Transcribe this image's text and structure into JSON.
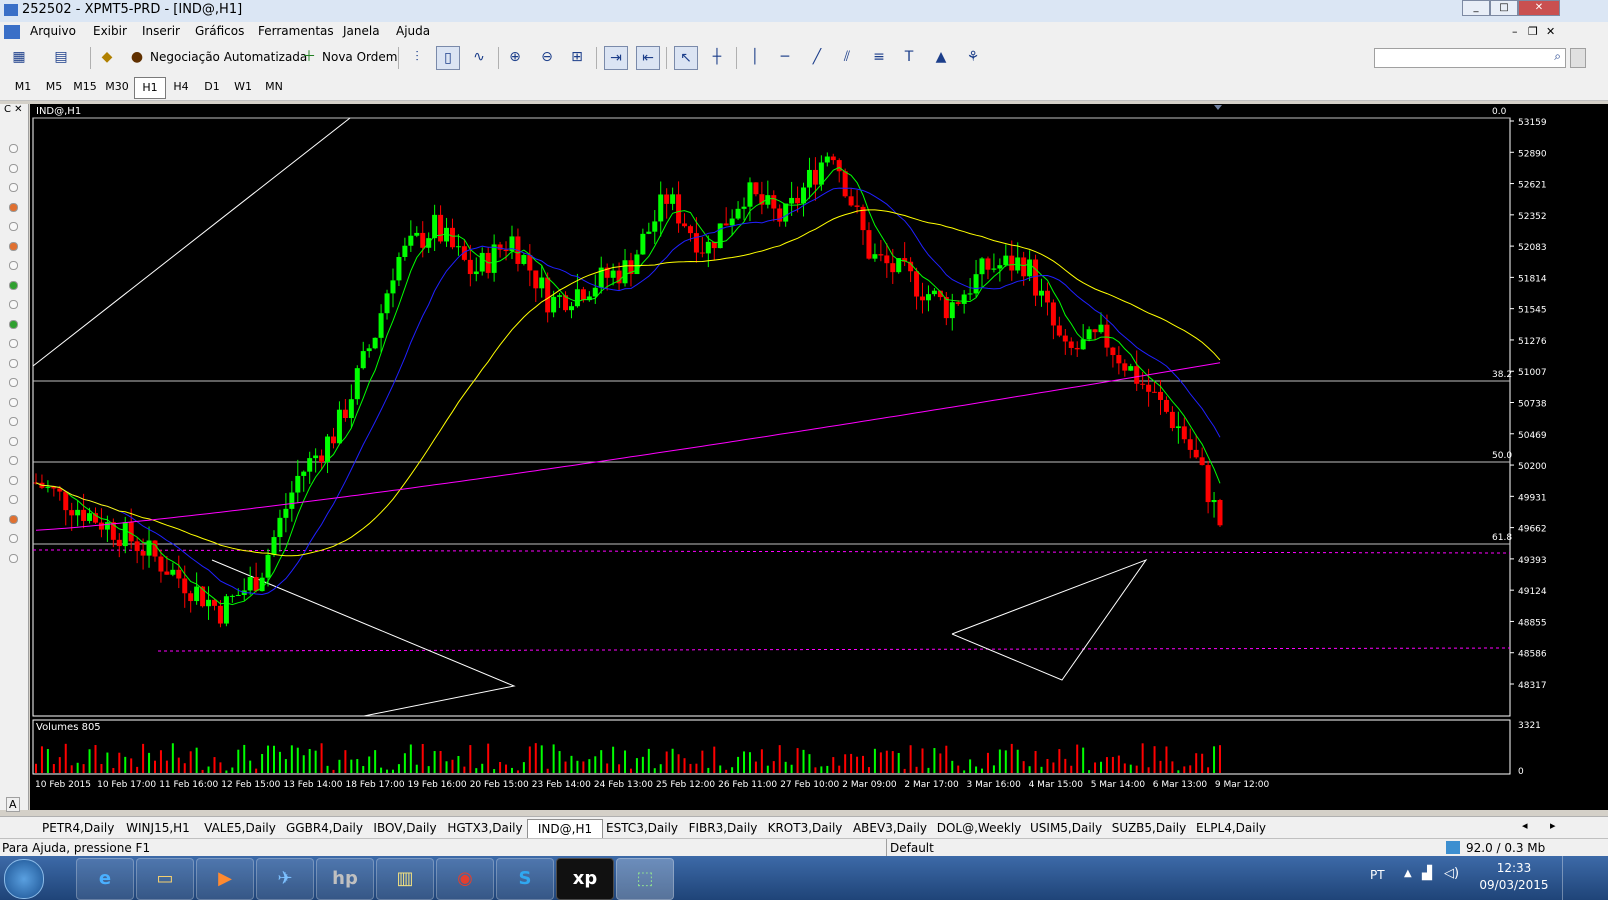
{
  "window": {
    "title": "252502 - XPMT5-PRD - [IND@,H1]"
  },
  "menu": [
    "Arquivo",
    "Exibir",
    "Inserir",
    "Gráficos",
    "Ferramentas",
    "Janela",
    "Ajuda"
  ],
  "toolbar": {
    "auto_trading": "Negociação Automatizada",
    "new_order": "Nova Ordem"
  },
  "timeframes": [
    "M1",
    "M5",
    "M15",
    "M30",
    "H1",
    "H4",
    "D1",
    "W1",
    "MN"
  ],
  "selected_timeframe": "H1",
  "chart": {
    "symbol_label": "IND@,H1",
    "volumes_label": "Volumes 805",
    "volume_scale": [
      "3321",
      "0"
    ],
    "fib_labels": [
      "0.0",
      "38.2",
      "50.0",
      "61.8"
    ],
    "price_ticks": [
      "53159",
      "52890",
      "52621",
      "52352",
      "52083",
      "51814",
      "51545",
      "51276",
      "51007",
      "50738",
      "50469",
      "50200",
      "49931",
      "49662",
      "49393",
      "49124",
      "48855",
      "48586",
      "48317"
    ],
    "time_labels": [
      "10 Feb 2015",
      "10 Feb 17:00",
      "11 Feb 16:00",
      "12 Feb 15:00",
      "13 Feb 14:00",
      "18 Feb 17:00",
      "19 Feb 16:00",
      "20 Feb 15:00",
      "23 Feb 14:00",
      "24 Feb 13:00",
      "25 Feb 12:00",
      "26 Feb 11:00",
      "27 Feb 10:00",
      "2 Mar 09:00",
      "2 Mar 17:00",
      "3 Mar 16:00",
      "4 Mar 15:00",
      "5 Mar 14:00",
      "6 Mar 13:00",
      "9 Mar 12:00"
    ],
    "colors": {
      "up": "#00ff00",
      "down": "#ff0000",
      "ma_fast": "#00ff00",
      "ma_mid": "#2020ff",
      "ma_slow": "#ffff00",
      "ma_long": "#ff00ff",
      "fib": "#c0c0c0"
    }
  },
  "chart_data": {
    "type": "candlestick",
    "symbol": "IND@",
    "timeframe": "H1",
    "ylim": [
      48317,
      53159
    ],
    "close_path": [
      [
        0,
        50050
      ],
      [
        10,
        49550
      ],
      [
        16,
        49150
      ],
      [
        19,
        48950
      ],
      [
        23,
        49250
      ],
      [
        27,
        50100
      ],
      [
        31,
        50500
      ],
      [
        35,
        51350
      ],
      [
        37,
        51950
      ],
      [
        41,
        52250
      ],
      [
        45,
        51850
      ],
      [
        49,
        52150
      ],
      [
        53,
        51600
      ],
      [
        57,
        51750
      ],
      [
        61,
        51900
      ],
      [
        65,
        52500
      ],
      [
        69,
        52050
      ],
      [
        73,
        52550
      ],
      [
        77,
        52300
      ],
      [
        82,
        52950
      ],
      [
        86,
        52000
      ],
      [
        90,
        51800
      ],
      [
        94,
        51550
      ],
      [
        98,
        51900
      ],
      [
        102,
        51950
      ],
      [
        106,
        51150
      ],
      [
        110,
        51300
      ],
      [
        114,
        50900
      ],
      [
        118,
        50500
      ],
      [
        120,
        50150
      ],
      [
        122,
        49700
      ]
    ],
    "fib_levels": {
      "0.0": 53159,
      "38.2": 51007,
      "50.0": 50335,
      "61.8": 49662
    },
    "volume_max": 3321
  },
  "tabs": [
    "PETR4,Daily",
    "WINJ15,H1",
    "VALE5,Daily",
    "GGBR4,Daily",
    "IBOV,Daily",
    "HGTX3,Daily",
    "IND@,H1",
    "ESTC3,Daily",
    "FIBR3,Daily",
    "KROT3,Daily",
    "ABEV3,Daily",
    "DOL@,Weekly",
    "USIM5,Daily",
    "SUZB5,Daily",
    "ELPL4,Daily"
  ],
  "selected_tab": "IND@,H1",
  "status": {
    "help": "Para Ajuda, pressione F1",
    "profile": "Default",
    "traffic": "92.0 / 0.3 Mb"
  },
  "taskbar": {
    "lang": "PT",
    "time": "12:33",
    "date": "09/03/2015",
    "xp_label": "xp"
  }
}
